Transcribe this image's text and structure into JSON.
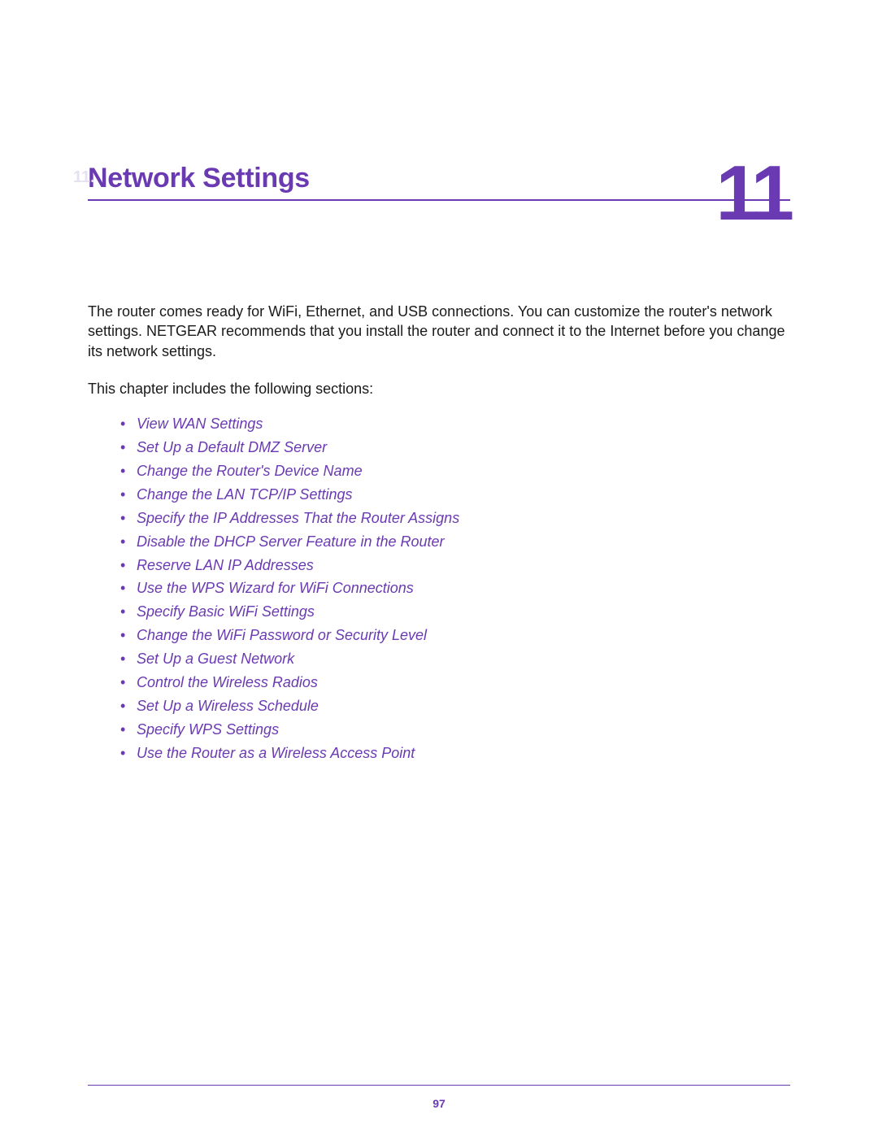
{
  "chapter": {
    "prefix": "11.",
    "title": "Network Settings",
    "number": "11"
  },
  "intro": {
    "paragraph": "The router comes ready for WiFi, Ethernet, and USB connections. You can customize the router's network settings. NETGEAR recommends that you install the router and connect it to the Internet before you change its network settings.",
    "sub": "This chapter includes the following sections:"
  },
  "toc": [
    "View WAN Settings",
    "Set Up a Default DMZ Server",
    "Change the Router's Device Name",
    "Change the LAN TCP/IP Settings",
    "Specify the IP Addresses That the Router Assigns",
    "Disable the DHCP Server Feature in the Router",
    "Reserve LAN IP Addresses",
    "Use the WPS Wizard for WiFi Connections",
    "Specify Basic WiFi Settings",
    "Change the WiFi Password or Security Level",
    "Set Up a Guest Network",
    "Control the Wireless Radios",
    "Set Up a Wireless Schedule",
    "Specify WPS Settings",
    "Use the Router as a Wireless Access Point"
  ],
  "footer": {
    "page_number": "97"
  }
}
